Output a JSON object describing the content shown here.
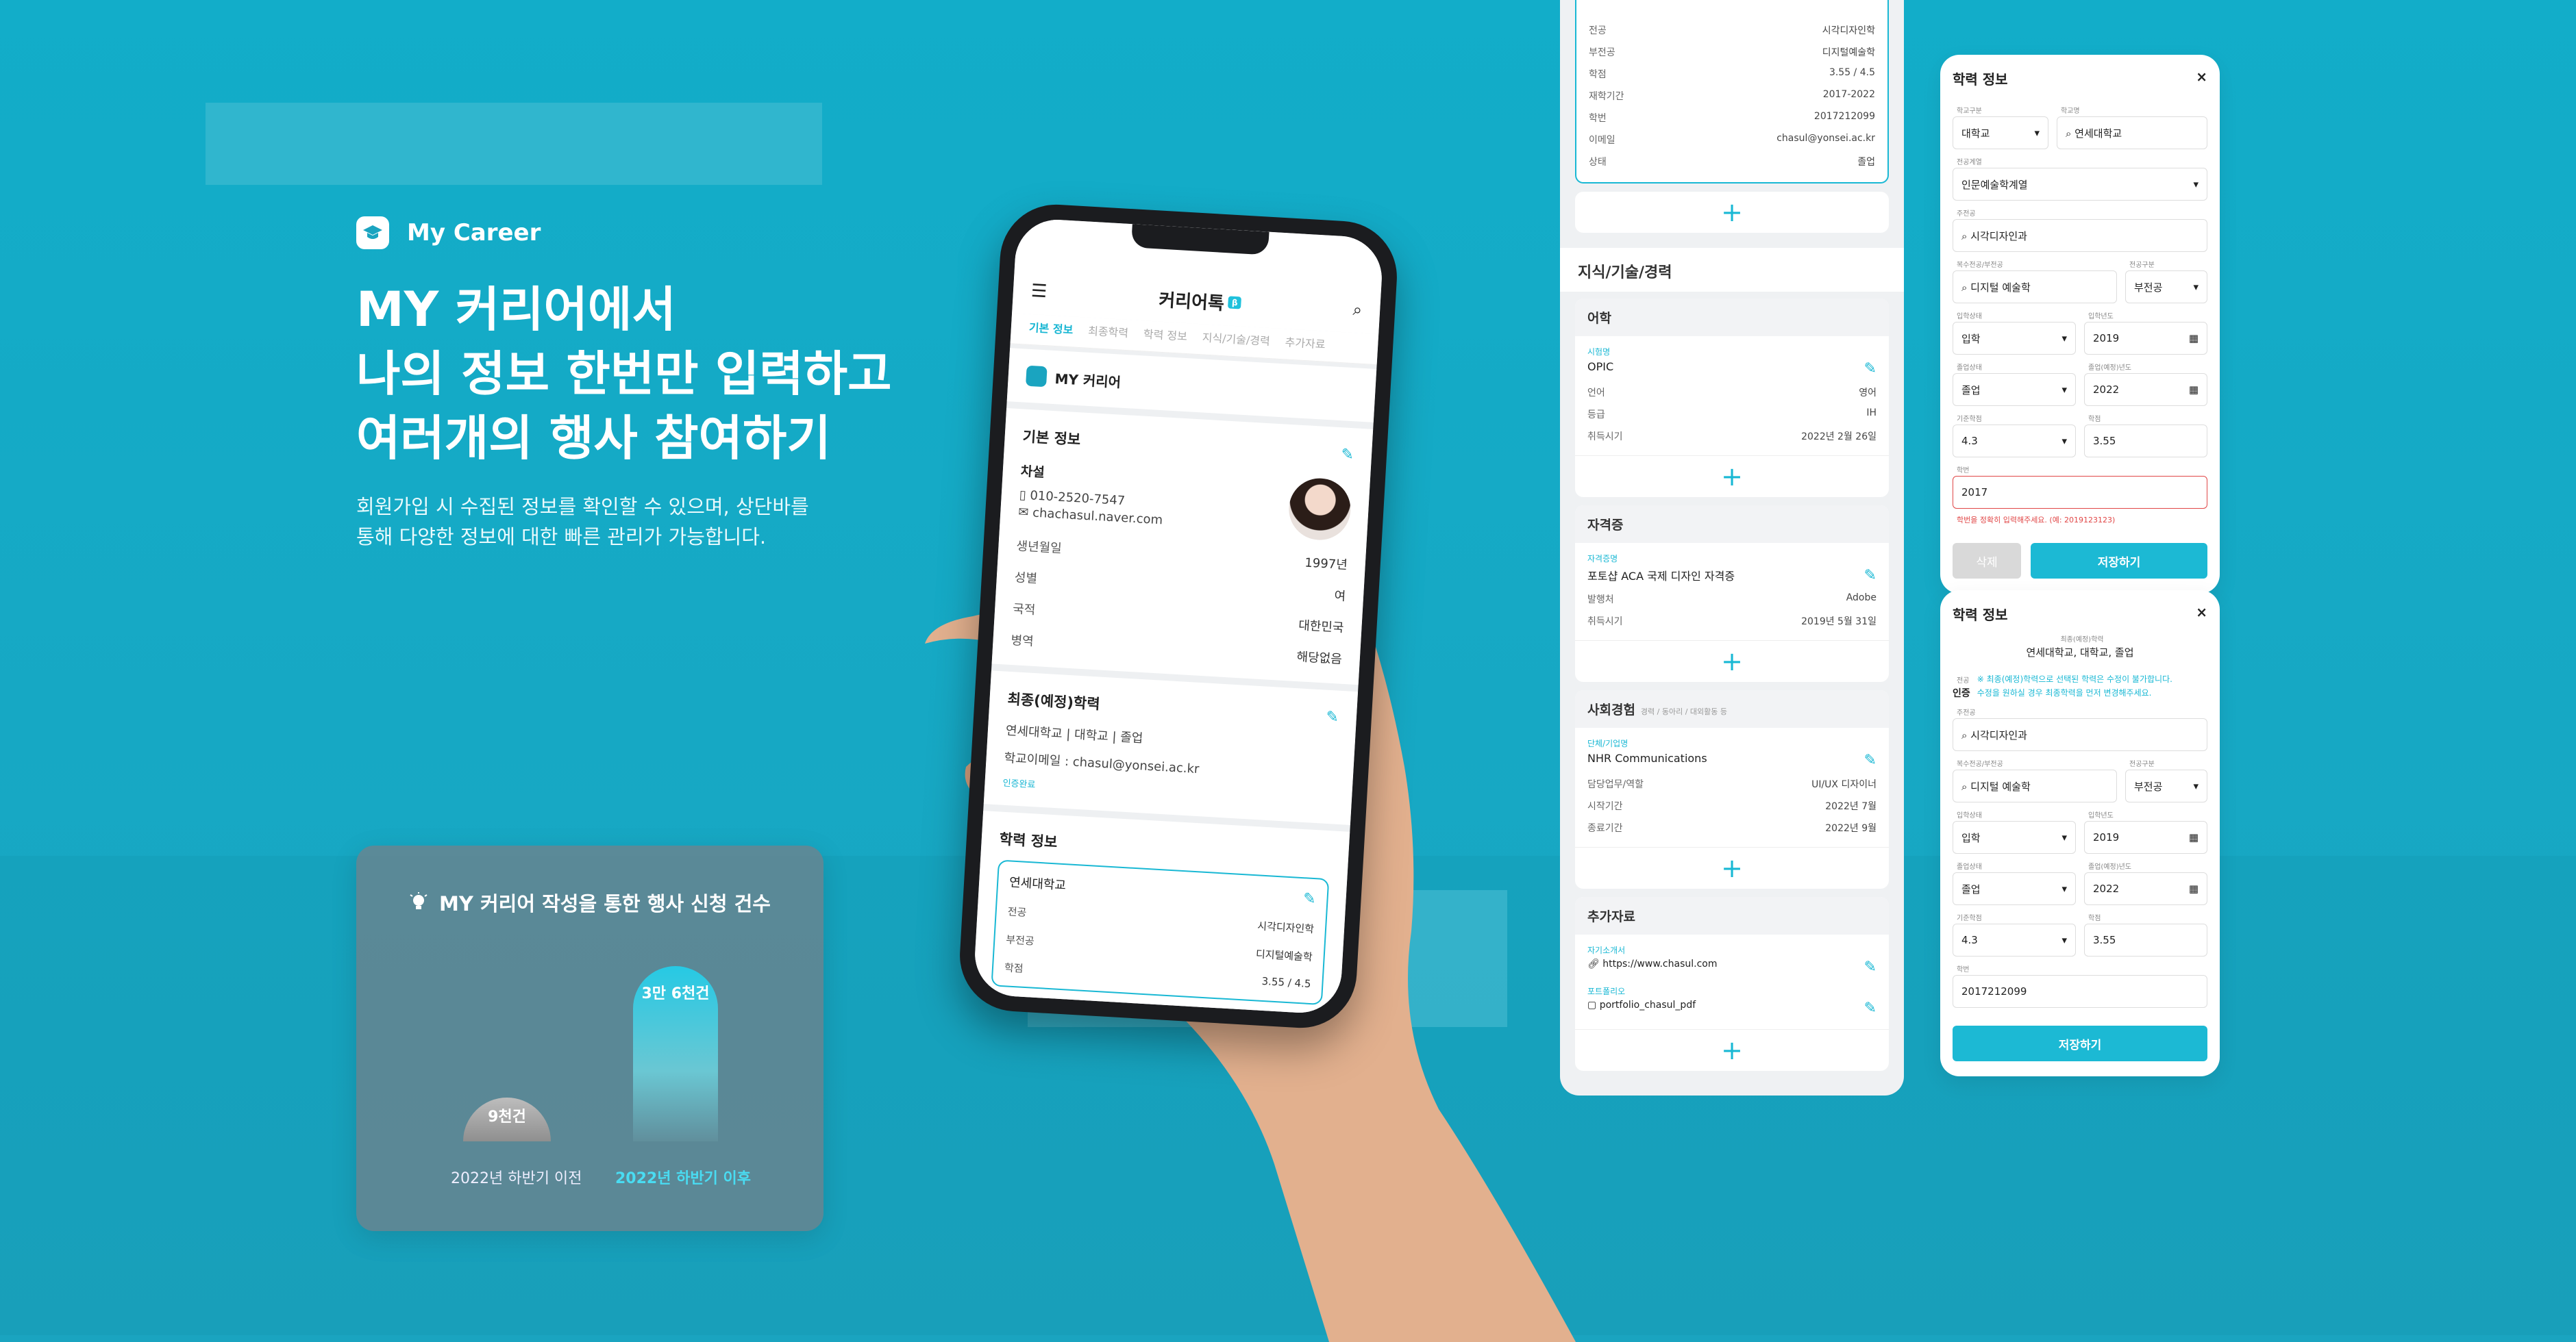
{
  "colors": {
    "accent": "#1cb9d4",
    "background": "#12adc9",
    "error": "#e14747"
  },
  "brand": {
    "icon": "graduation-cap-icon",
    "label": "My Career"
  },
  "hero": {
    "line1": "MY 커리어에서",
    "line2": "나의 정보 한번만 입력하고",
    "line3": "여러개의 행사 참여하기",
    "desc1": "회원가입 시 수집된 정보를  확인할 수 있으며, 상단바를",
    "desc2": "통해 다양한 정보에 대한 빠른 관리가 가능합니다."
  },
  "stats": {
    "icon": "lightbulb-icon",
    "title": "MY 커리어 작성을 통한 행사 신청 건수",
    "chart_data": {
      "type": "bar",
      "categories": [
        "2022년 하반기 이전",
        "2022년 하반기 이후"
      ],
      "values": [
        9000,
        36000
      ],
      "value_labels": [
        "9천건",
        "3만 6천건"
      ]
    }
  },
  "phone": {
    "app_title": "커리어톡",
    "app_tag": "β",
    "tabs": [
      "기본 정보",
      "최종학력",
      "학력 정보",
      "지식/기술/경력",
      "추가자료"
    ],
    "my_career": "MY 커리어",
    "basic": {
      "title": "기본 정보",
      "name": "차설",
      "phone": "010-2520-7547",
      "email": "chachasul.naver.com",
      "rows": [
        {
          "k": "생년월일",
          "v": "1997년"
        },
        {
          "k": "성별",
          "v": "여"
        },
        {
          "k": "국적",
          "v": "대한민국"
        },
        {
          "k": "병역",
          "v": "해당없음"
        }
      ]
    },
    "final": {
      "title": "최종(예정)학력",
      "school": "연세대학교",
      "degree": "대학교",
      "status": "졸업",
      "email_label": "학교이메일 :",
      "email": "chasul@yonsei.ac.kr",
      "verify": "인증완료"
    },
    "edu": {
      "title": "학력 정보",
      "school": "연세대학교",
      "rows": [
        {
          "k": "전공",
          "v": "시각디자인학"
        },
        {
          "k": "부전공",
          "v": "디지털예술학"
        },
        {
          "k": "학점",
          "v": "3.55 / 4.5"
        }
      ]
    }
  },
  "mid": {
    "top_rows": [
      {
        "k": "전공",
        "v": "시각디자인학"
      },
      {
        "k": "부전공",
        "v": "디지털예술학"
      },
      {
        "k": "학점",
        "v": "3.55 / 4.5"
      },
      {
        "k": "재학기간",
        "v": "2017-2022"
      },
      {
        "k": "학번",
        "v": "2017212099"
      },
      {
        "k": "이메일",
        "v": "chasul@yonsei.ac.kr"
      },
      {
        "k": "상태",
        "v": "졸업"
      }
    ],
    "section": "지식/기술/경력",
    "lang": {
      "title": "어학",
      "label": "시험명",
      "name": "OPIC",
      "rows": [
        {
          "k": "언어",
          "v": "영어"
        },
        {
          "k": "등급",
          "v": "IH"
        },
        {
          "k": "취득시기",
          "v": "2022년 2월 26일"
        }
      ]
    },
    "cert": {
      "title": "자격증",
      "label": "자격증명",
      "name": "포토샵 ACA 국제 디자인 자격증",
      "rows": [
        {
          "k": "발행처",
          "v": "Adobe"
        },
        {
          "k": "취득시기",
          "v": "2019년 5월 31일"
        }
      ]
    },
    "social": {
      "title": "사회경험",
      "sub": "경력 / 동아리 / 대외활동 등",
      "label": "단체/기업명",
      "name": "NHR Communications",
      "rows": [
        {
          "k": "담당업무/역할",
          "v": "UI/UX 디자이너"
        },
        {
          "k": "시작기간",
          "v": "2022년 7월"
        },
        {
          "k": "종료기간",
          "v": "2022년 9월"
        }
      ]
    },
    "extra": {
      "title": "추가자료",
      "label1": "자기소개서",
      "val1": "https://www.chasul.com",
      "label2": "포트폴리오",
      "val2": "portfolio_chasul_pdf"
    }
  },
  "form1": {
    "title": "학력 정보",
    "l_type": "학교구분",
    "type": "대학교",
    "l_name": "학교명",
    "name": "연세대학교",
    "l_field": "전공계열",
    "field": "인문예술학계열",
    "l_major": "주전공",
    "major": "시각디자인과",
    "l_minor": "복수전공/부전공",
    "minor": "디지털 예술학",
    "l_minor_type": "전공구분",
    "minor_type": "부전공",
    "l_in": "입학상태",
    "in": "입학",
    "l_in_year": "입학년도",
    "in_year": "2019",
    "l_out": "졸업상태",
    "out": "졸업",
    "l_out_year": "졸업(예정)년도",
    "out_year": "2022",
    "l_base": "기준학점",
    "base": "4.3",
    "l_gpa": "학점",
    "gpa": "3.55",
    "l_id": "학번",
    "id": "2017",
    "error": "학번을 정확히 입력해주세요. (예: 2019123123)",
    "delete": "삭제",
    "save": "저장하기"
  },
  "form2": {
    "title": "학력 정보",
    "l_final": "최종(예정)학력",
    "final": "연세대학교, 대학교, 졸업",
    "l_major_label": "전공",
    "major_prefix": "인증",
    "info1": "※ 최종(예정)학력으로 선택된 학력은 수정이 불가합니다.",
    "info2": "수정을 원하실 경우 최종학력을 먼저 변경해주세요.",
    "l_major": "주전공",
    "major": "시각디자인과",
    "l_minor": "복수전공/부전공",
    "minor": "디지털 예술학",
    "l_minor_type": "전공구분",
    "minor_type": "부전공",
    "l_in": "입학상태",
    "in": "입학",
    "l_in_year": "입학년도",
    "in_year": "2019",
    "l_out": "졸업상태",
    "out": "졸업",
    "l_out_year": "졸업(예정)년도",
    "out_year": "2022",
    "l_base": "기준학점",
    "base": "4.3",
    "l_gpa": "학점",
    "gpa": "3.55",
    "l_id": "학번",
    "id": "2017212099",
    "save": "저장하기"
  }
}
